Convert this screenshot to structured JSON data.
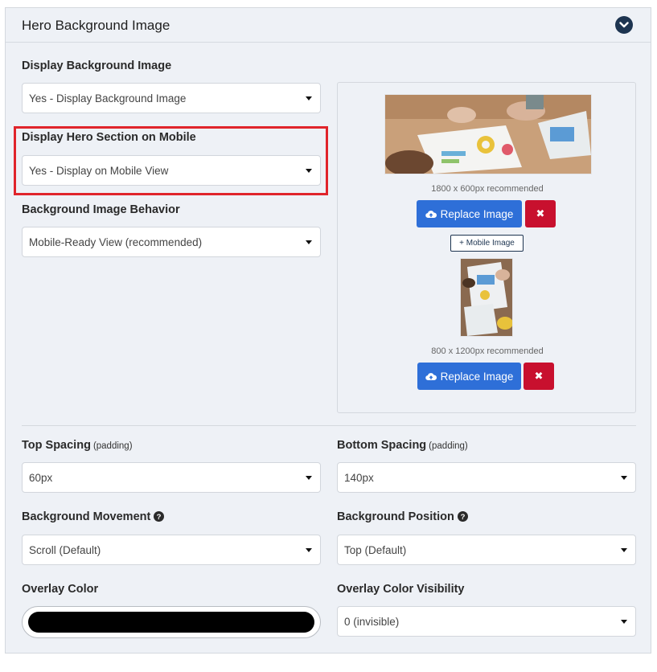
{
  "panel": {
    "title": "Hero Background Image",
    "collapse_icon": "chevron-down-icon"
  },
  "display_bg": {
    "label": "Display Background Image",
    "value": "Yes - Display Background Image"
  },
  "display_mobile": {
    "label": "Display Hero Section on Mobile",
    "value": "Yes - Display on Mobile View"
  },
  "bg_behavior": {
    "label": "Background Image Behavior",
    "value": "Mobile-Ready View (recommended)"
  },
  "desktop_image": {
    "recommended": "1800 x 600px recommended",
    "replace_label": "Replace Image",
    "remove_label": "✖"
  },
  "mobile_image": {
    "add_label": "+ Mobile Image",
    "recommended": "800 x 1200px recommended",
    "replace_label": "Replace Image",
    "remove_label": "✖"
  },
  "top_spacing": {
    "label": "Top Spacing",
    "hint": "(padding)",
    "value": "60px"
  },
  "bottom_spacing": {
    "label": "Bottom Spacing",
    "hint": "(padding)",
    "value": "140px"
  },
  "bg_movement": {
    "label": "Background Movement",
    "value": "Scroll (Default)"
  },
  "bg_position": {
    "label": "Background Position",
    "value": "Top (Default)"
  },
  "overlay_color": {
    "label": "Overlay Color",
    "value_color": "#000000"
  },
  "overlay_visibility": {
    "label": "Overlay Color Visibility",
    "value": "0 (invisible)"
  },
  "colors": {
    "primary": "#2e6fd8",
    "danger": "#c8102e",
    "highlight": "#e0242b",
    "header_icon": "#1d3450"
  }
}
